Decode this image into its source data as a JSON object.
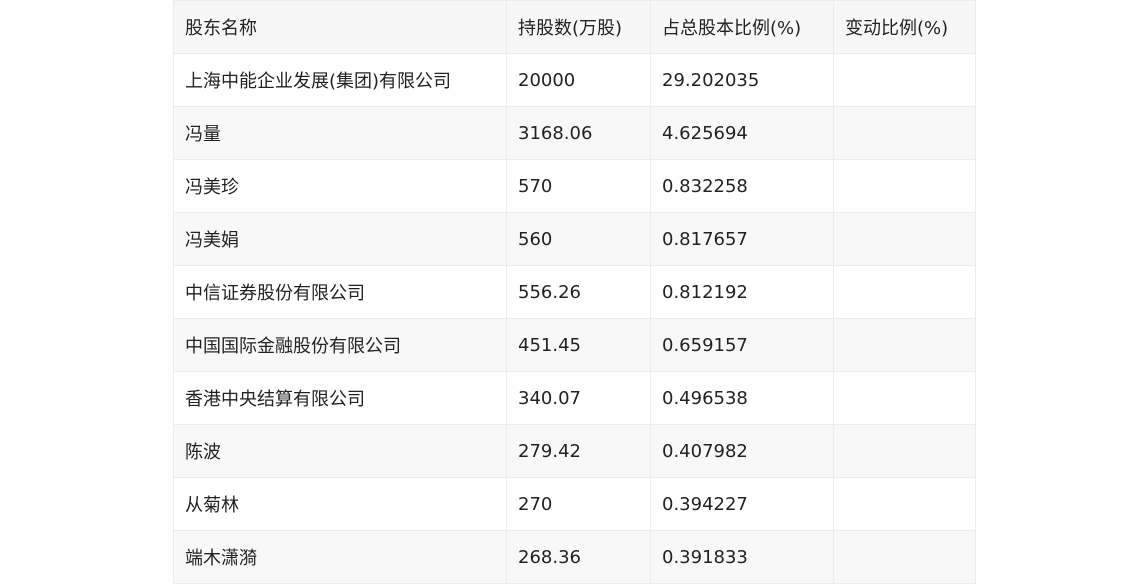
{
  "table": {
    "headers": [
      "股东名称",
      "持股数(万股)",
      "占总股本比例(%)",
      "变动比例(%)"
    ],
    "rows": [
      {
        "name": "上海中能企业发展(集团)有限公司",
        "shares": "20000",
        "ratio": "29.202035",
        "change": ""
      },
      {
        "name": "冯量",
        "shares": "3168.06",
        "ratio": "4.625694",
        "change": ""
      },
      {
        "name": "冯美珍",
        "shares": "570",
        "ratio": "0.832258",
        "change": ""
      },
      {
        "name": "冯美娟",
        "shares": "560",
        "ratio": "0.817657",
        "change": ""
      },
      {
        "name": "中信证券股份有限公司",
        "shares": "556.26",
        "ratio": "0.812192",
        "change": ""
      },
      {
        "name": "中国国际金融股份有限公司",
        "shares": "451.45",
        "ratio": "0.659157",
        "change": ""
      },
      {
        "name": "香港中央结算有限公司",
        "shares": "340.07",
        "ratio": "0.496538",
        "change": ""
      },
      {
        "name": "陈波",
        "shares": "279.42",
        "ratio": "0.407982",
        "change": ""
      },
      {
        "name": "从菊林",
        "shares": "270",
        "ratio": "0.394227",
        "change": ""
      },
      {
        "name": "端木潇漪",
        "shares": "268.36",
        "ratio": "0.391833",
        "change": ""
      }
    ]
  }
}
